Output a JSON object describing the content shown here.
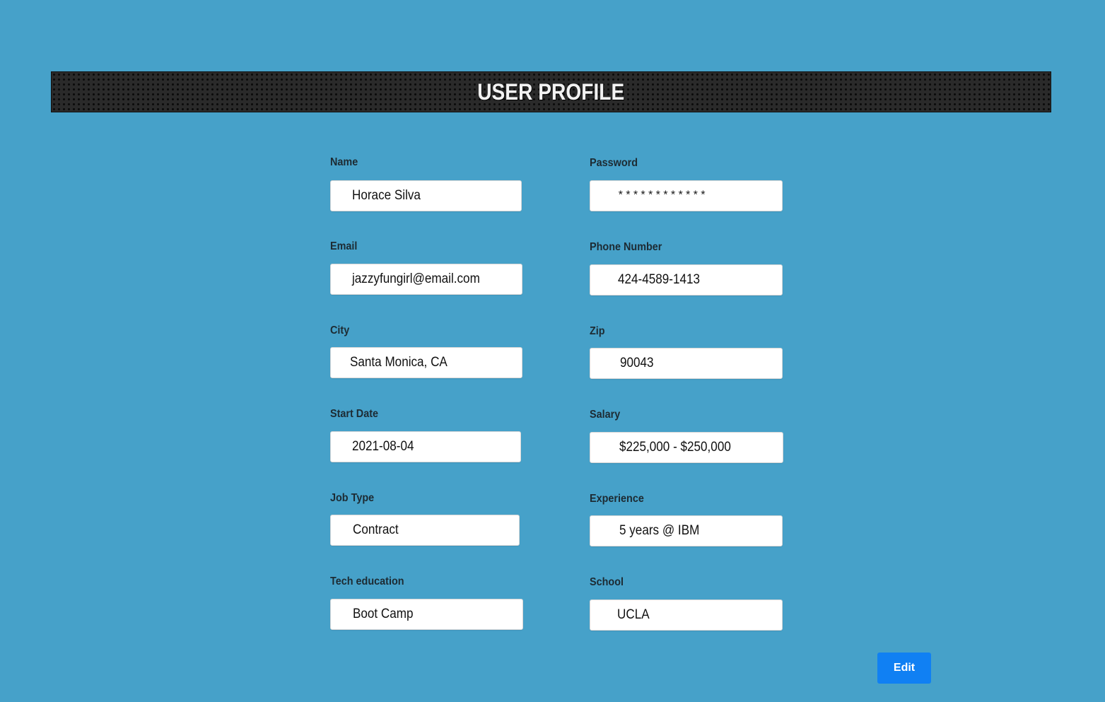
{
  "header": {
    "title": "USER PROFILE"
  },
  "fields": {
    "name": {
      "label": "Name",
      "value": "Horace Silva"
    },
    "password": {
      "label": "Password",
      "value": "************"
    },
    "email": {
      "label": "Email",
      "value": "jazzyfungirl@email.com"
    },
    "phone": {
      "label": "Phone Number",
      "value": "424-4589-1413"
    },
    "city": {
      "label": "City",
      "value": "Santa Monica, CA"
    },
    "zip": {
      "label": "Zip",
      "value": "90043"
    },
    "start_date": {
      "label": "Start Date",
      "value": "2021-08-04"
    },
    "salary": {
      "label": "Salary",
      "value": "$225,000 - $250,000"
    },
    "job_type": {
      "label": "Job Type",
      "value": "Contract"
    },
    "experience": {
      "label": "Experience",
      "value": "5 years @ IBM"
    },
    "tech_education": {
      "label": "Tech education",
      "value": "Boot Camp"
    },
    "school": {
      "label": "School",
      "value": "UCLA"
    }
  },
  "actions": {
    "edit_label": "Edit"
  },
  "colors": {
    "background": "#46a1c9",
    "header": "#2a2a2a",
    "button": "#1080f3"
  }
}
